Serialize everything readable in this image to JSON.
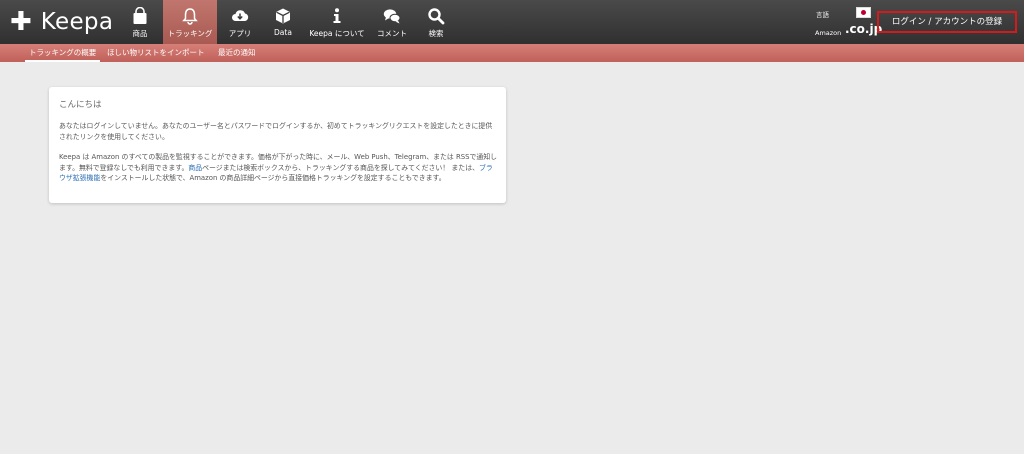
{
  "app": {
    "logo_symbol": "✚",
    "logo_text": "Keepa"
  },
  "nav": [
    {
      "id": "products",
      "label": "商品",
      "icon": "shopping-bag-icon"
    },
    {
      "id": "tracking",
      "label": "トラッキング",
      "icon": "bell-icon",
      "active": true
    },
    {
      "id": "apps",
      "label": "アプリ",
      "icon": "cloud-download-icon"
    },
    {
      "id": "data",
      "label": "Data",
      "icon": "cube-icon"
    },
    {
      "id": "about",
      "label": "Keepa について",
      "icon": "info-icon"
    },
    {
      "id": "comments",
      "label": "コメント",
      "icon": "comments-icon"
    },
    {
      "id": "search",
      "label": "検索",
      "icon": "search-icon"
    }
  ],
  "locale": {
    "language_label": "言語",
    "amazon_label": "Amazon",
    "domain": ".co.jp",
    "flag": "japan-flag-icon"
  },
  "login_button": "ログイン / アカウントの登録",
  "subnav": [
    {
      "label": "トラッキングの概要",
      "active": true
    },
    {
      "label": "ほしい物リストをインポート"
    },
    {
      "label": "最近の通知"
    }
  ],
  "card": {
    "greeting": "こんにちは",
    "para1": "あなたはログインしていません。あなたのユーザー名とパスワードでログインするか、初めてトラッキングリクエストを設定したときに提供されたリンクを使用してください。",
    "para2_a": "Keepa は Amazon のすべての製品を監視することができます。価格が下がった時に、メール、Web Push、Telegram、または RSSで通知します。無料で登録なしでも利用できます。",
    "link1": "商品",
    "para2_b": "ページまたは検索ボックスから、トラッキングする商品を探してみてください！ または、",
    "link2": "ブラウザ拡張機能",
    "para2_c": "をインストールした状態で、Amazon の商品詳細ページから直接価格トラッキングを設定することもできます。"
  },
  "colors": {
    "topbar": "#3a3a3a",
    "subbar": "#c9655f",
    "active_tab": "#b0645c",
    "login_border": "#d41a1a",
    "link": "#2a6db5"
  }
}
